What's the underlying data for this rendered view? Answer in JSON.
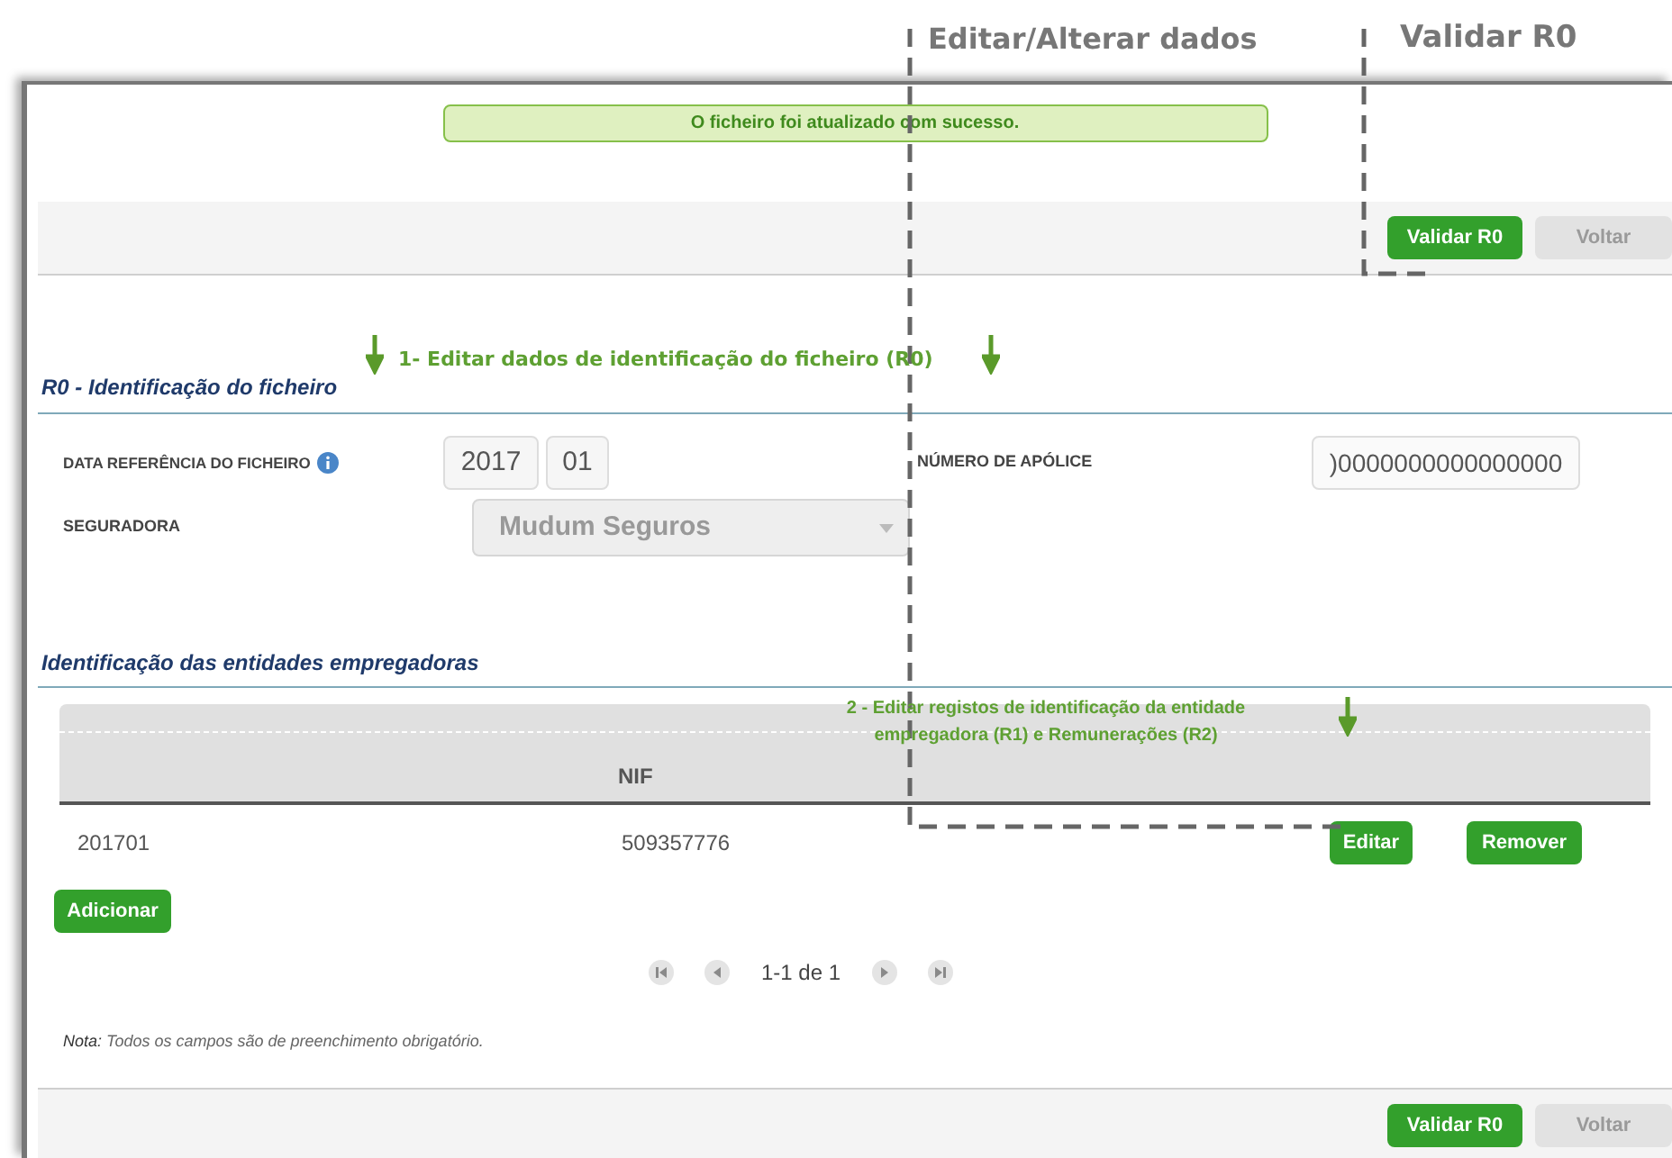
{
  "callouts": [
    {
      "text": "Editar/Alterar dados"
    },
    {
      "text": "Validar R0"
    }
  ],
  "message": "O ficheiro foi atualizado com sucesso.",
  "toolbar_top": {
    "buttons": [
      {
        "label": "Validar R0",
        "disabled": false
      },
      {
        "label": "Voltar",
        "disabled": true
      }
    ]
  },
  "section_r0": {
    "title": "R0 - Identificação do ficheiro",
    "hint": "1- Editar dados de identificação do ficheiro (R0)",
    "fields": {
      "date_label": "DATA REFERÊNCIA DO FICHEIRO",
      "year": "2017",
      "month": "01",
      "policy_label": "NÚMERO DE APÓLICE",
      "policy": ")0000000000000000",
      "insurer_label": "SEGURADORA",
      "insurer": "Mudum Seguros"
    }
  },
  "section_employers": {
    "title": "Identificação das entidades empregadoras",
    "hint": "2 - Editar registos de identificação da entidade empregadora (R1) e Remunerações (R2)",
    "table": {
      "columns": [
        "",
        "NIF"
      ],
      "rows": [
        {
          "cells": [
            "201701",
            "509357776"
          ],
          "actions": [
            "Editar",
            "Remover"
          ]
        }
      ]
    },
    "add_button": "Adicionar",
    "pagination": "1-1 de 1"
  },
  "note": {
    "label": "Nota:",
    "text": "Todos os campos são de preenchimento obrigatório."
  },
  "toolbar_bottom": {
    "buttons": [
      {
        "label": "Validar R0",
        "disabled": false
      },
      {
        "label": "Voltar",
        "disabled": true
      }
    ]
  }
}
